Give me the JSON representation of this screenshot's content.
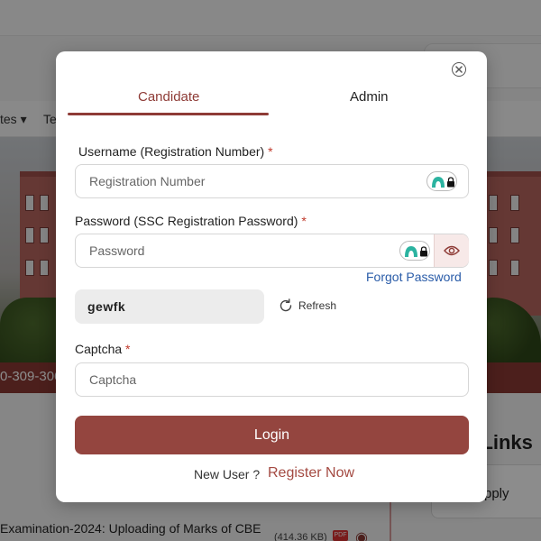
{
  "background": {
    "nav_items": [
      "tes ▾",
      "Te"
    ],
    "phone_text": "0-309-306",
    "links_title": "t Links",
    "apply_text": "pply",
    "news_text": "Examination-2024: Uploading of Marks of CBE",
    "file_size": "(414.36 KB)",
    "pdf_badge": "PDF"
  },
  "modal": {
    "tabs": [
      {
        "label": "Candidate",
        "active": true
      },
      {
        "label": "Admin",
        "active": false
      }
    ],
    "username": {
      "label": "Username (Registration Number)",
      "required_mark": "*",
      "placeholder": "Registration Number",
      "value": ""
    },
    "password": {
      "label": "Password (SSC Registration Password)",
      "required_mark": "*",
      "placeholder": "Password",
      "value": ""
    },
    "forgot_password": "Forgot Password",
    "captcha_image_text": "gewfk",
    "refresh_label": "Refresh",
    "captcha": {
      "label": "Captcha",
      "required_mark": "*",
      "placeholder": "Captcha",
      "value": ""
    },
    "login_label": "Login",
    "new_user_text": "New User ?",
    "register_label": "Register Now"
  },
  "colors": {
    "accent": "#8e3b36",
    "button": "#94453f",
    "link": "#2a5ca8"
  },
  "icons": {
    "close": "close-circle-icon",
    "password_manager": "password-manager-icon",
    "eye": "eye-icon",
    "refresh": "refresh-icon"
  }
}
